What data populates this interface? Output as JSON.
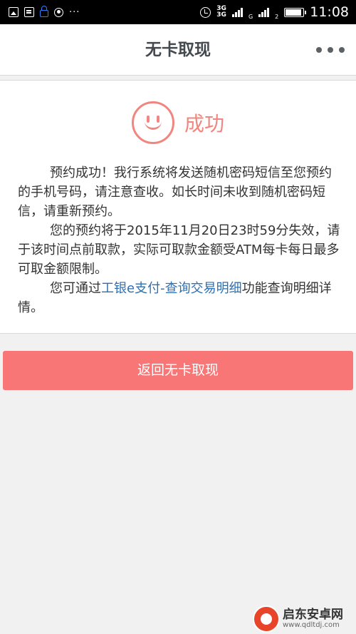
{
  "status_bar": {
    "network_label_1": "3G",
    "network_label_2": "3G",
    "network_sub_1": "G",
    "network_sub_2": "2",
    "time": "11:08",
    "battery_level": 0.9
  },
  "app_bar": {
    "title": "无卡取现",
    "more_icon": "more-horizontal-icon"
  },
  "result": {
    "icon": "smile-icon",
    "title": "成功",
    "paragraph_1": "预约成功！我行系统将发送随机密码短信至您预约的手机号码，请注意查收。如长时间未收到随机密码短信，请重新预约。",
    "paragraph_2": "您的预约将于2015年11月20日23时59分失效，请于该时间点前取款，实际可取款金额受ATM每卡每日最多可取金额限制。",
    "paragraph_3_prefix": "您可通过",
    "paragraph_3_link": "工银e支付-查询交易明细",
    "paragraph_3_suffix": "功能查询明细详情。",
    "accent_color": "#f0867f",
    "link_color": "#2f6fb0"
  },
  "actions": {
    "return_label": "返回无卡取现",
    "button_color": "#f87676"
  },
  "watermark": {
    "name": "启东安卓网",
    "url": "www.qdltdj.com"
  }
}
